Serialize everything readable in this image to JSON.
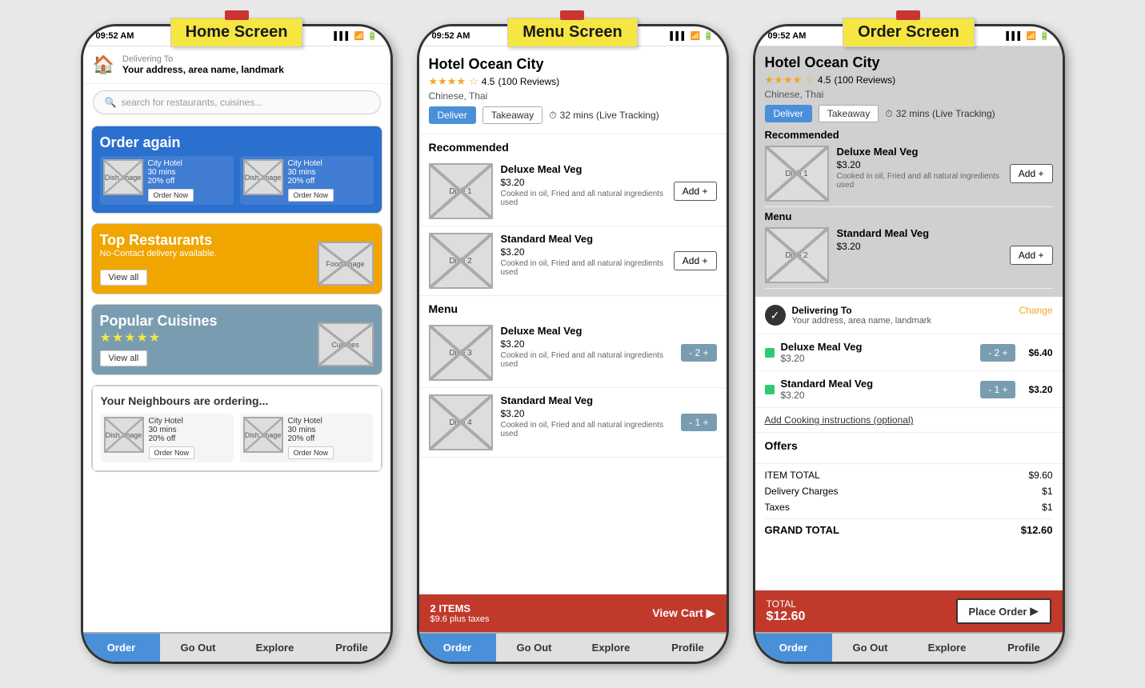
{
  "screens": {
    "home": {
      "label": "Home Screen",
      "status_time": "09:52 AM",
      "delivering_to": "Delivering To",
      "address": "Your address, area name, landmark",
      "search_placeholder": "search for restaurants, cuisines...",
      "order_again": {
        "title": "Order again",
        "items": [
          {
            "image_label": "Dish Image",
            "hotel": "City Hotel",
            "time": "30 mins",
            "discount": "20% off",
            "btn": "Order Now"
          },
          {
            "image_label": "Dish Image",
            "hotel": "City Hotel",
            "time": "30 mins",
            "discount": "20% off",
            "btn": "Order Now"
          }
        ]
      },
      "top_restaurants": {
        "title": "Top Restaurants",
        "subtitle": "No-Contact delivery available.",
        "view_all": "View all",
        "food_image": "Food Image"
      },
      "popular_cuisines": {
        "title": "Popular Cuisines",
        "stars": "★★★★★",
        "view_all": "View all",
        "image_label": "Cuisines"
      },
      "neighbours": {
        "title": "Your Neighbours are ordering...",
        "items": [
          {
            "image_label": "Dish Image",
            "hotel": "City Hotel",
            "time": "30 mins",
            "discount": "20% off",
            "btn": "Order Now"
          },
          {
            "image_label": "Dish Image",
            "hotel": "City Hotel",
            "time": "30 mins",
            "discount": "20% off",
            "btn": "Order Now"
          }
        ]
      },
      "nav": [
        "Order",
        "Go Out",
        "Explore",
        "Profile"
      ]
    },
    "menu": {
      "label": "Menu Screen",
      "status_time": "09:52 AM",
      "restaurant_name": "Hotel Ocean City",
      "rating": "4.5",
      "reviews": "(100 Reviews)",
      "cuisines": "Chinese, Thai",
      "deliver_btn": "Deliver",
      "takeaway_btn": "Takeaway",
      "time_info": "32 mins (Live Tracking)",
      "recommended_title": "Recommended",
      "menu_title": "Menu",
      "dishes": {
        "recommended": [
          {
            "label": "Dish 1",
            "name": "Deluxe Meal Veg",
            "price": "$3.20",
            "desc": "Cooked in oil, Fried and all natural ingredients used",
            "btn": "Add +"
          },
          {
            "label": "Dish 2",
            "name": "Standard Meal Veg",
            "price": "$3.20",
            "desc": "Cooked in oil, Fried and all natural ingredients used",
            "btn": "Add +"
          }
        ],
        "menu": [
          {
            "label": "Dish 3",
            "name": "Deluxe Meal Veg",
            "price": "$3.20",
            "desc": "Cooked in oil, Fried and all natural ingredients used",
            "btn": "- 2 +"
          },
          {
            "label": "Dish 4",
            "name": "Standard Meal Veg",
            "price": "$3.20",
            "desc": "Cooked in oil, Fried and all natural ingredients used",
            "btn": "- 1 +"
          }
        ]
      },
      "cart": {
        "items": "2 ITEMS",
        "price": "$9.6 plus taxes",
        "btn": "View Cart ▶"
      },
      "nav": [
        "Order",
        "Go Out",
        "Explore",
        "Profile"
      ]
    },
    "order": {
      "label": "Order Screen",
      "status_time": "09:52 AM",
      "restaurant_name": "Hotel Ocean City",
      "rating": "4.5",
      "reviews": "(100 Reviews)",
      "cuisines": "Chinese, Thai",
      "deliver_btn": "Deliver",
      "takeaway_btn": "Takeaway",
      "time_info": "32 mins (Live Tracking)",
      "recommended_title": "Recommended",
      "menu_title": "Menu",
      "dishes_grey": {
        "recommended": [
          {
            "label": "Dish 1",
            "name": "Deluxe Meal Veg",
            "price": "$3.20",
            "desc": "Cooked in oil, Fried and all natural ingredients used",
            "btn": "Add +"
          },
          {
            "label": "Dish 2",
            "name": "Standard Meal Veg",
            "price": "$3.20",
            "btn": ""
          }
        ]
      },
      "delivering": {
        "label": "Delivering To",
        "address": "Your address, area name, landmark",
        "change": "Change"
      },
      "order_items": [
        {
          "name": "Deluxe Meal Veg",
          "price": "$3.20",
          "qty_btn": "- 2 +",
          "total": "$6.40"
        },
        {
          "name": "Standard Meal Veg",
          "price": "$3.20",
          "qty_btn": "- 1 +",
          "total": "$3.20"
        }
      ],
      "cooking_instructions": "Add Cooking instructions (optional)",
      "offers_title": "Offers",
      "price_breakdown": [
        {
          "label": "ITEM TOTAL",
          "value": "$9.60"
        },
        {
          "label": "Delivery Charges",
          "value": "$1"
        },
        {
          "label": "Taxes",
          "value": "$1"
        },
        {
          "label": "GRAND TOTAL",
          "value": "$12.60",
          "bold": true
        }
      ],
      "total": {
        "label": "TOTAL",
        "amount": "$12.60",
        "btn": "Place Order"
      },
      "nav": [
        "Order",
        "Go Out",
        "Explore",
        "Profile"
      ]
    }
  }
}
